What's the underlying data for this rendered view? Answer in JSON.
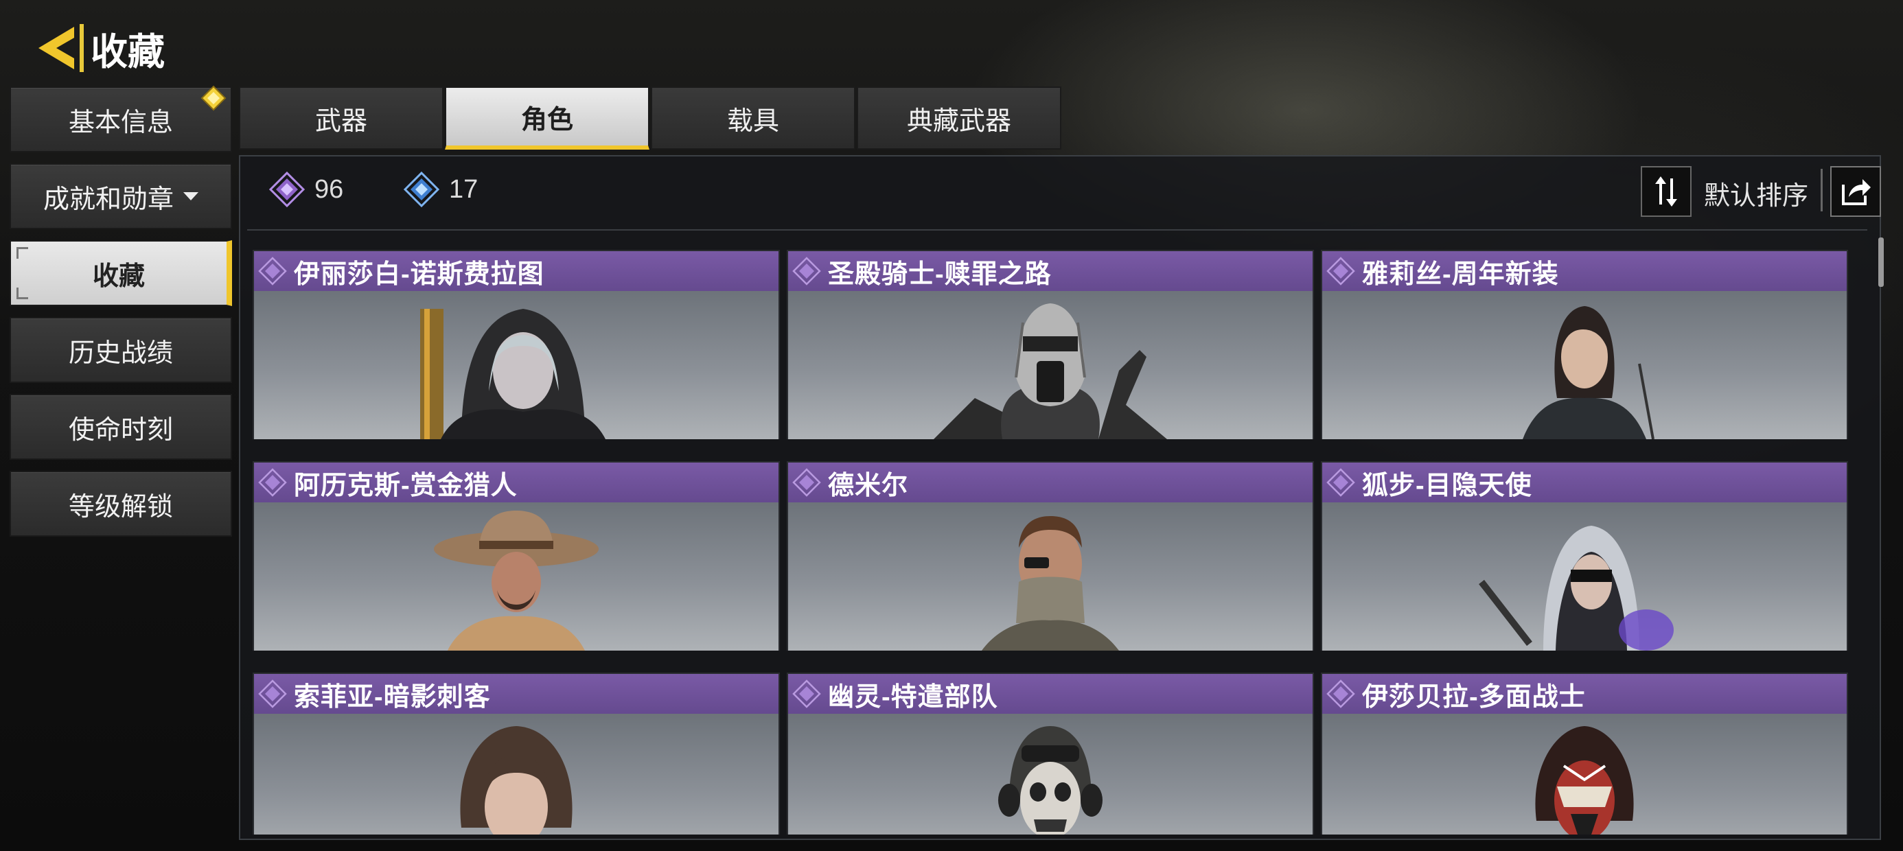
{
  "header": {
    "title": "收藏",
    "back_icon": "back-arrow-icon"
  },
  "sidebar": {
    "items": [
      {
        "label": "基本信息",
        "badge_icon": "new-diamond-icon"
      },
      {
        "label": "成就和勋章",
        "has_dropdown": true
      },
      {
        "label": "收藏",
        "active": true
      },
      {
        "label": "历史战绩"
      },
      {
        "label": "使命时刻"
      },
      {
        "label": "等级解锁"
      }
    ]
  },
  "tabs": [
    {
      "label": "武器"
    },
    {
      "label": "角色",
      "active": true
    },
    {
      "label": "载具"
    },
    {
      "label": "典藏武器"
    }
  ],
  "stats": {
    "purple": {
      "icon": "purple-diamond-icon",
      "value": "96"
    },
    "blue": {
      "icon": "blue-diamond-icon",
      "value": "17"
    }
  },
  "sort": {
    "label": "默认排序",
    "icon": "sort-arrows-icon",
    "share_icon": "share-icon"
  },
  "colors": {
    "accent": "#f0c62c",
    "rarity_purple": "#6d4f98",
    "blue": "#4f8fd8"
  },
  "cards": [
    {
      "title": "伊丽莎白-诺斯费拉图"
    },
    {
      "title": "圣殿骑士-赎罪之路"
    },
    {
      "title": "雅莉丝-周年新装"
    },
    {
      "title": "阿历克斯-赏金猎人"
    },
    {
      "title": "德米尔"
    },
    {
      "title": "狐步-目隐天使"
    },
    {
      "title": "索菲亚-暗影刺客"
    },
    {
      "title": "幽灵-特遣部队"
    },
    {
      "title": "伊莎贝拉-多面战士"
    }
  ]
}
